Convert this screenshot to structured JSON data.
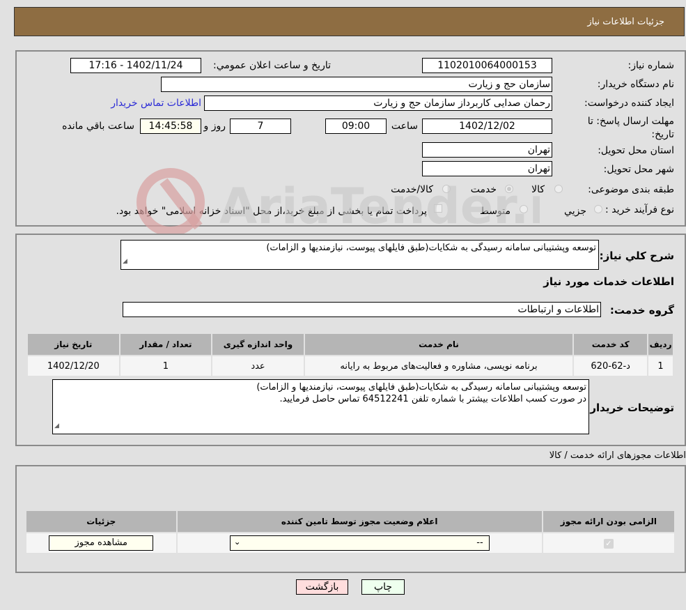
{
  "header": {
    "title": "جزئیات اطلاعات نیاز"
  },
  "form": {
    "need_number": {
      "label": "شماره نیاز:",
      "value": "1102010064000153"
    },
    "announce": {
      "label": "تاریخ و ساعت اعلان عمومي:",
      "value": "1402/11/24 - 17:16"
    },
    "buyer_org": {
      "label": "نام دستگاه خریدار:",
      "value": "سازمان حج و زیارت"
    },
    "requester": {
      "label": "ایجاد کننده درخواست:",
      "value": "رحمان  صدایی کاربرداز سازمان حج و زیارت",
      "contact_link": "اطلاعات تماس خریدار"
    },
    "deadline": {
      "label": "مهلت ارسال پاسخ: تا تاریخ:",
      "date": "1402/12/02",
      "time_label": "ساعت",
      "time": "09:00",
      "days": "7",
      "days_label": "روز و",
      "remaining": "14:45:58",
      "remaining_label": "ساعت باقي مانده"
    },
    "province": {
      "label": "استان محل تحویل:",
      "value": "تهران"
    },
    "city": {
      "label": "شهر محل تحویل:",
      "value": "تهران"
    },
    "category": {
      "label": "طبقه بندی موضوعی:",
      "options": [
        "کالا",
        "خدمت",
        "کالا/خدمت"
      ],
      "selected": "خدمت"
    },
    "purchase_type": {
      "label": "نوع فرآیند خرید :",
      "options": [
        "جزيي",
        "متوسط"
      ],
      "treasury_note": "پرداخت تمام یا بخشی از مبلغ خرید،از محل \"اسناد خزانه اسلامی\" خواهد بود."
    }
  },
  "description": {
    "label": "شرح کلي نیاز:",
    "value": "توسعه وپشتیبانی سامانه رسیدگی به شکایات(طبق فایلهای پیوست، نیازمندیها و الزامات)",
    "services_title": "اطلاعات خدمات مورد نیاز",
    "service_group_label": "گروه خدمت:",
    "service_group": "اطلاعات و ارتباطات"
  },
  "services_table": {
    "headers": [
      "ردیف",
      "کد خدمت",
      "نام خدمت",
      "واحد اندازه گیری",
      "تعداد / مقدار",
      "تاریخ نیاز"
    ],
    "rows": [
      [
        "1",
        "د-62-620",
        "برنامه نویسی، مشاوره و فعالیت‌های مربوط به رایانه",
        "عدد",
        "1",
        "1402/12/20"
      ]
    ]
  },
  "buyer_notes": {
    "label": "توضیحات خریدار:",
    "line1": "توسعه وپشتیبانی سامانه رسیدگی به شکایات(طبق فایلهای پیوست، نیازمندیها و الزامات)",
    "line2": "در صورت کسب اطلاعات بیشتر با شماره تلفن 64512241 تماس حاصل فرمایید."
  },
  "licenses": {
    "title": "اطلاعات مجوزهای ارائه خدمت / کالا",
    "headers": [
      "الزامی بودن ارائه مجوز",
      "اعلام وضعیت مجوز توسط تامین کننده",
      "جزئیات"
    ],
    "row": {
      "required": true,
      "status": "--",
      "details_button": "مشاهده مجوز"
    }
  },
  "buttons": {
    "print": "چاپ",
    "back": "بازگشت"
  },
  "colors": {
    "header_bg": "#8e6d42",
    "link": "#2a2ad6",
    "print_bg": "#eeffee",
    "back_bg": "#ffdddd"
  }
}
